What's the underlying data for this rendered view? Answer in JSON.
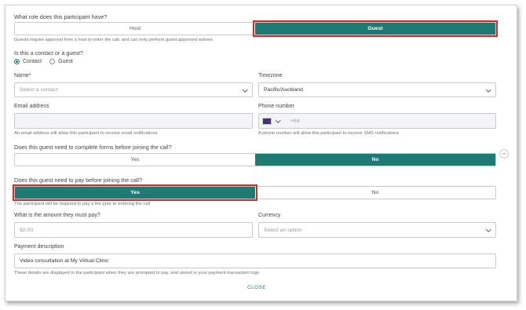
{
  "role": {
    "question": "What role does this participant have?",
    "options": [
      "Host",
      "Guest"
    ],
    "help": "Guests require approval from a host to enter the call, and can only perform guest approved actions"
  },
  "contact_or_guest": {
    "question": "Is this a contact or a guest?",
    "options": [
      "Contact",
      "Guest"
    ]
  },
  "name": {
    "label": "Name*",
    "placeholder": "Select a contact"
  },
  "timezone": {
    "label": "Timezone",
    "value": "Pacific/Auckland"
  },
  "email": {
    "label": "Email address",
    "help": "An email address will allow this participant to receive email notifications"
  },
  "phone": {
    "label": "Phone number",
    "placeholder": "+64",
    "help": "A phone number will allow this participant to receive SMS notifications"
  },
  "forms": {
    "question": "Does this guest need to complete forms before joining the call?",
    "options": [
      "Yes",
      "No"
    ],
    "collapse_symbol": "–"
  },
  "pay": {
    "question": "Does this guest need to pay before joining the call?",
    "options": [
      "Yes",
      "No"
    ],
    "help": "The participant will be required to pay a fee prior to entering the call"
  },
  "amount": {
    "label": "What is the amount they must pay?",
    "placeholder": "$0.00"
  },
  "currency": {
    "label": "Currency",
    "placeholder": "Select an option"
  },
  "payment_description": {
    "label": "Payment description",
    "value": "Video consultation at My Virtual Clinic",
    "help": "These details are displayed to the participant when they are prompted to pay, and stored in your payment transaction logs"
  },
  "footer": {
    "close_label": "CLOSE"
  },
  "colors": {
    "accent": "#1f7a74",
    "highlight": "#d32b2b"
  }
}
